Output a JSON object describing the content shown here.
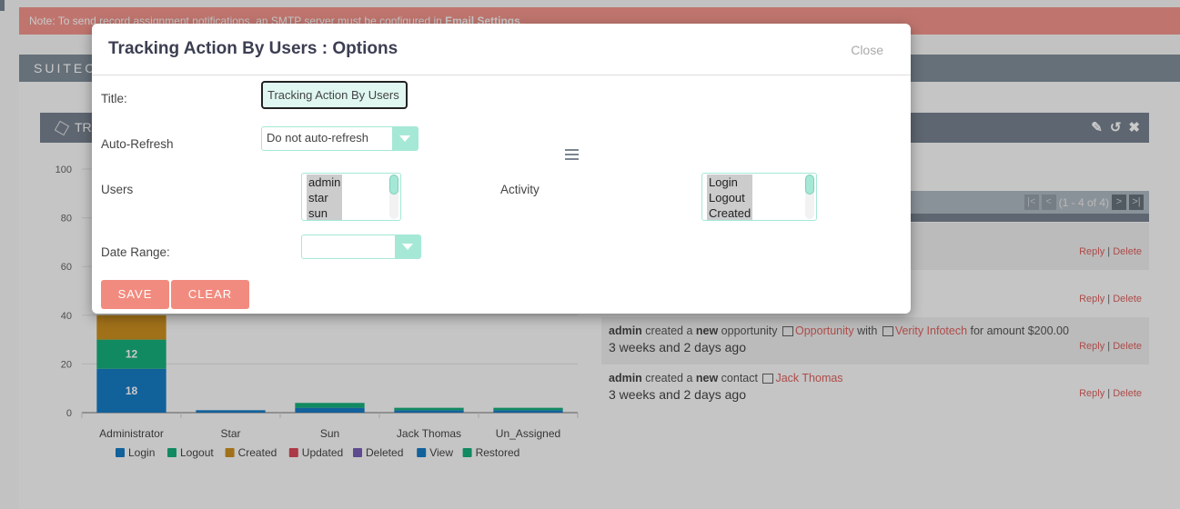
{
  "notice": {
    "text": "Note: To send record assignment notifications, an SMTP server must be configured in ",
    "link": "Email Settings",
    "end": "."
  },
  "dashboard_tab": "SUITECRM DASHBOARD",
  "dashlet": {
    "title": "TRACKING ACTION BY USERS",
    "tools": {
      "edit": "pencil-icon",
      "refresh": "refresh-icon",
      "close": "close-icon"
    }
  },
  "chart_data": {
    "type": "bar",
    "stacked": true,
    "categories": [
      "Administrator",
      "Star",
      "Sun",
      "Jack Thomas",
      "Un_Assigned"
    ],
    "series": [
      {
        "name": "Login",
        "color": "#0070c0",
        "values": [
          18,
          1,
          2,
          1,
          1
        ]
      },
      {
        "name": "Logout",
        "color": "#00a870",
        "values": [
          12,
          0,
          2,
          1,
          1
        ]
      },
      {
        "name": "Created",
        "color": "#c8860c",
        "values": [
          10,
          0,
          0,
          0,
          0
        ]
      },
      {
        "name": "Updated",
        "color": "#d9364a",
        "values": [
          0,
          0,
          0,
          0,
          0
        ]
      },
      {
        "name": "Deleted",
        "color": "#6a4fb0",
        "values": [
          0,
          0,
          0,
          0,
          0
        ]
      },
      {
        "name": "View",
        "color": "#0070c0",
        "values": [
          0,
          0,
          0,
          0,
          0
        ]
      },
      {
        "name": "Restored",
        "color": "#00a870",
        "values": [
          0,
          0,
          0,
          0,
          0
        ]
      }
    ],
    "data_labels": [
      {
        "category": "Administrator",
        "series": "Login",
        "text": "18"
      },
      {
        "category": "Administrator",
        "series": "Logout",
        "text": "12"
      }
    ],
    "yticks": [
      "0",
      "20",
      "40",
      "60",
      "80",
      "100"
    ],
    "ylim": [
      0,
      100
    ],
    "grid": true,
    "legend": "bottom",
    "title": "",
    "xlabel": "",
    "ylabel": ""
  },
  "activity_stream": {
    "pager_text": "(1 - 4 of 4)",
    "rows": [
      {
        "line": "",
        "time": "",
        "reply": "Reply",
        "sep": "|",
        "delete": "Delete"
      },
      {
        "line": "",
        "time": "",
        "reply": "Reply",
        "sep": "|",
        "delete": "Delete"
      },
      {
        "user": "admin",
        "mid1": " created a ",
        "new": "new",
        "mid2": " opportunity ",
        "link1": "Opportunity",
        "mid3": " with ",
        "link2": "Verity Infotech",
        "end": " for amount $200.00",
        "time": "3 weeks and 2 days ago",
        "reply": "Reply",
        "sep": "|",
        "delete": "Delete"
      },
      {
        "user": "admin",
        "mid1": " created a ",
        "new": "new",
        "mid2": " contact ",
        "link1": "Jack Thomas",
        "time": "3 weeks and 2 days ago",
        "reply": "Reply",
        "sep": "|",
        "delete": "Delete"
      }
    ]
  },
  "modal": {
    "title": "Tracking Action By Users : Options",
    "close": "Close",
    "fields": {
      "title_label": "Title:",
      "title_value": "Tracking Action By Users",
      "autorefresh_label": "Auto-Refresh",
      "autorefresh_value": "Do not auto-refresh",
      "users_label": "Users",
      "users_options": [
        "admin",
        "star",
        "sun"
      ],
      "activity_label": "Activity",
      "activity_options": [
        "Login",
        "Logout",
        "Created"
      ],
      "daterange_label": "Date Range:",
      "daterange_value": ""
    },
    "save": "SAVE",
    "clear": "CLEAR"
  }
}
